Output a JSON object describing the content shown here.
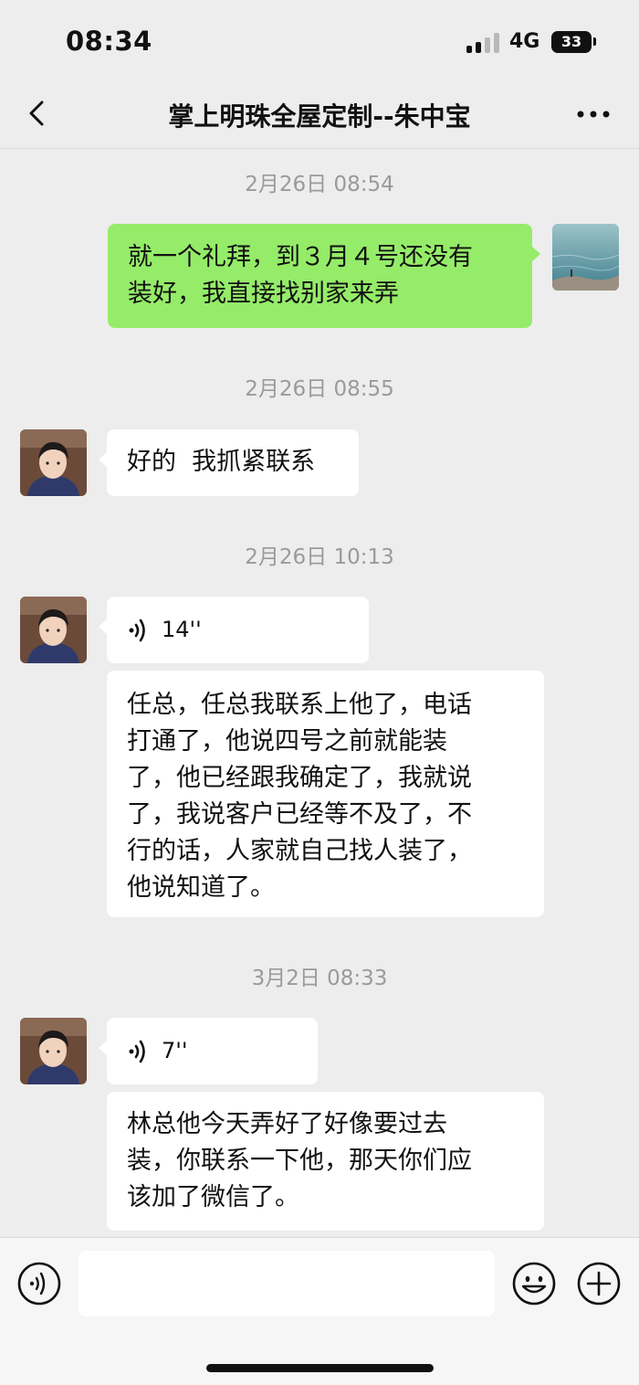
{
  "status_bar": {
    "time": "08:34",
    "network": "4G",
    "battery": "33"
  },
  "nav": {
    "title": "掌上明珠全屋定制--朱中宝"
  },
  "messages": {
    "ts1": "2月26日 08:54",
    "m1": {
      "sender": "self",
      "line1": "就一个礼拜，到３月４号还没有",
      "line2": "装好，我直接找别家来弄"
    },
    "ts2": "2月26日 08:55",
    "m2": {
      "sender": "contact",
      "text": "好的  我抓紧联系"
    },
    "ts3": "2月26日 10:13",
    "m3": {
      "sender": "contact",
      "type": "voice",
      "duration": "14''"
    },
    "m4": {
      "sender": "contact",
      "lines": [
        "任总，任总我联系上他了，电话",
        "打通了，他说四号之前就能装",
        "了，他已经跟我确定了，我就说",
        "了，我说客户已经等不及了，不",
        "行的话，人家就自己找人装了，",
        "他说知道了。"
      ]
    },
    "ts4": "3月2日 08:33",
    "m5": {
      "sender": "contact",
      "type": "voice",
      "duration": "7''"
    },
    "m6": {
      "sender": "contact",
      "lines": [
        "林总他今天弄好了好像要过去",
        "装，你联系一下他，那天你们应",
        "该加了微信了。"
      ]
    }
  },
  "input_bar": {
    "placeholder": ""
  },
  "colors": {
    "self_bubble": "#95ec69",
    "contact_bubble": "#ffffff",
    "background": "#ededed"
  },
  "icons": [
    "back-icon",
    "more-icon",
    "voice-icon",
    "emoji-icon",
    "plus-icon"
  ]
}
